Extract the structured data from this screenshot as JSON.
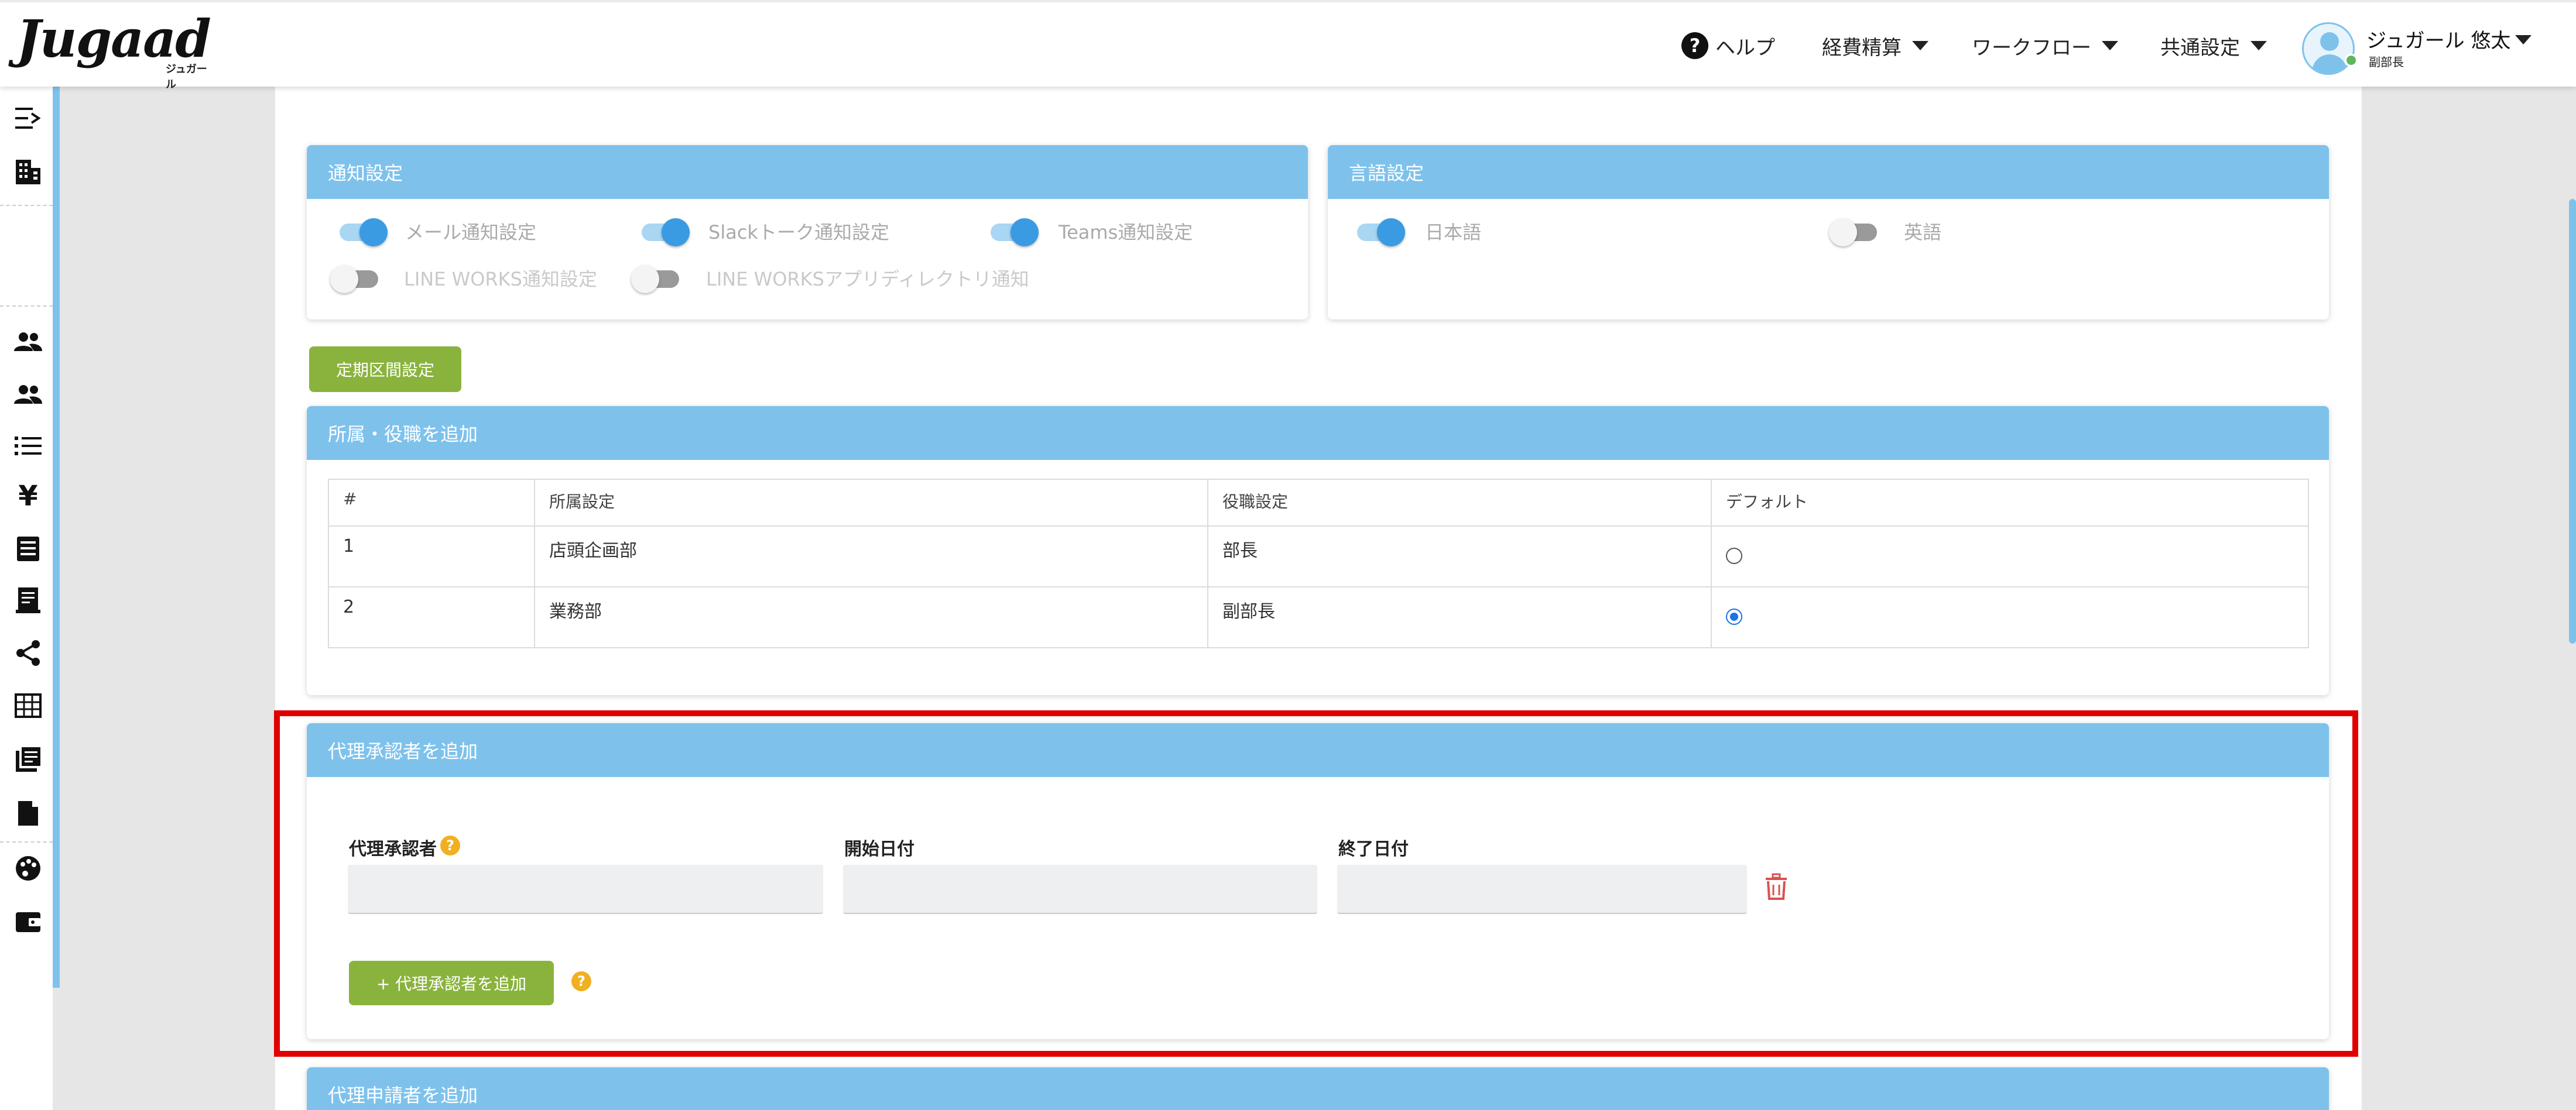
{
  "app": {
    "logo": "Jugaad",
    "logo_sub": "ジュガール"
  },
  "header": {
    "help": "ヘルプ",
    "menus": [
      "経費精算",
      "ワークフロー",
      "共通設定"
    ],
    "user_name": "ジュガール 悠太",
    "user_role": "副部長"
  },
  "sidebar_icons": [
    "expand-menu-icon",
    "building-icon",
    "users-icon",
    "users-alt-icon",
    "list-icon",
    "yen-icon",
    "ledger-icon",
    "receipt-icon",
    "share-icon",
    "grid-icon",
    "journal-icon",
    "document-icon",
    "palette-icon",
    "wallet-icon"
  ],
  "notify": {
    "title": "通知設定",
    "mail": "メール通知設定",
    "slack": "Slackトーク通知設定",
    "teams": "Teams通知設定",
    "lineworks": "LINE WORKS通知設定",
    "lineworks_dir": "LINE WORKSアプリディレクトリ通知"
  },
  "language": {
    "title": "言語設定",
    "ja": "日本語",
    "en": "英語"
  },
  "commute_button": "定期区間設定",
  "affiliation": {
    "title": "所属・役職を追加",
    "headers": [
      "#",
      "所属設定",
      "役職設定",
      "デフォルト"
    ],
    "rows": [
      {
        "no": "1",
        "dept": "店頭企画部",
        "role": "部長",
        "default": false
      },
      {
        "no": "2",
        "dept": "業務部",
        "role": "副部長",
        "default": true
      }
    ]
  },
  "proxy_approver": {
    "title": "代理承認者を追加",
    "approver_label": "代理承認者",
    "start_label": "開始日付",
    "end_label": "終了日付",
    "add_button": "+ 代理承認者を追加"
  },
  "proxy_applicant": {
    "title": "代理申請者を追加"
  },
  "colors": {
    "primary": "#7ec2ec",
    "green": "#8ab33e",
    "highlight": "#e00000",
    "delete": "#d9534f"
  }
}
